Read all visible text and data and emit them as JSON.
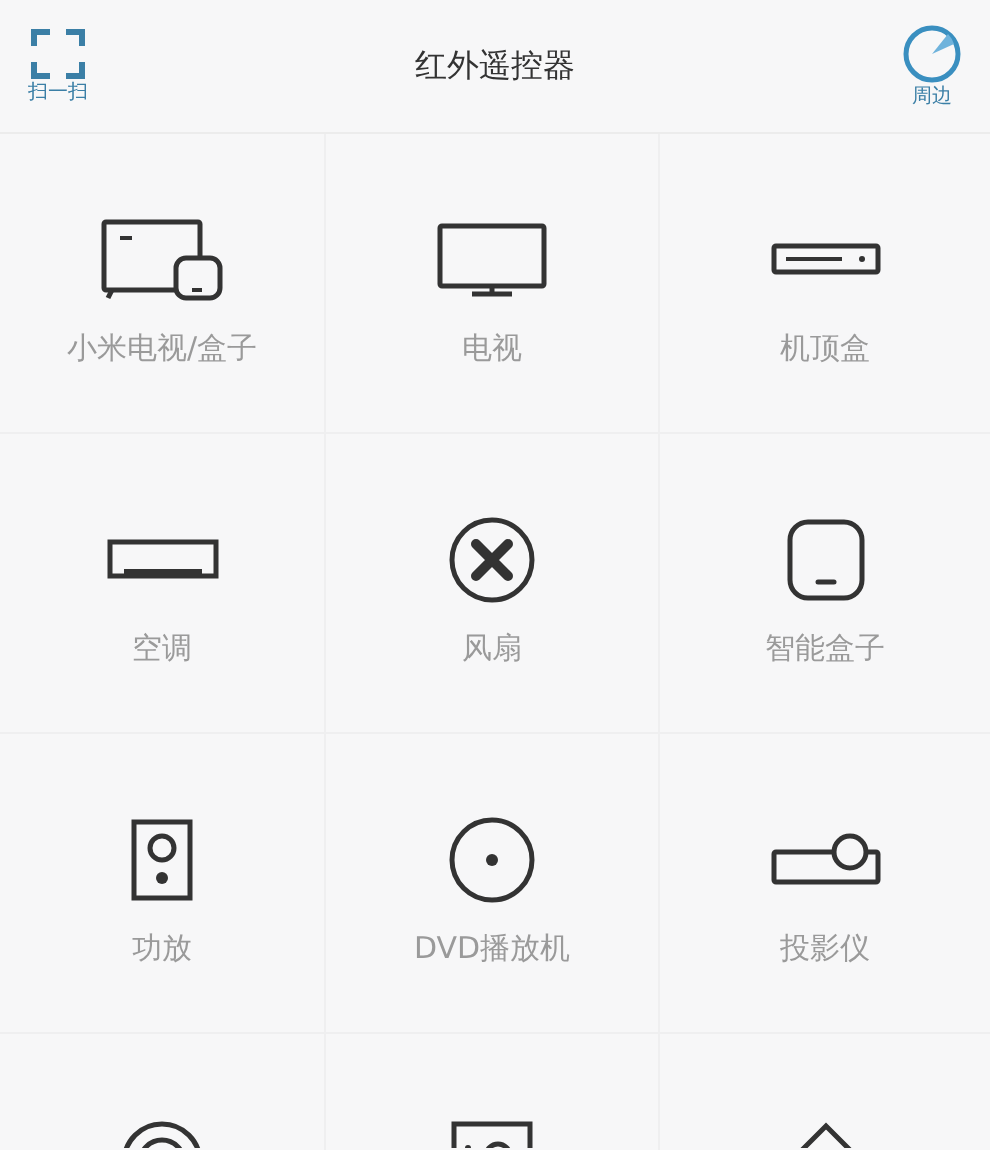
{
  "header": {
    "scan": {
      "label": "扫一扫"
    },
    "title": "红外遥控器",
    "nearby": {
      "label": "周边"
    }
  },
  "devices": [
    {
      "kind": "mitv",
      "label": "小米电视/盒子"
    },
    {
      "kind": "tv",
      "label": "电视"
    },
    {
      "kind": "stb",
      "label": "机顶盒"
    },
    {
      "kind": "ac",
      "label": "空调"
    },
    {
      "kind": "fan",
      "label": "风扇"
    },
    {
      "kind": "box",
      "label": "智能盒子"
    },
    {
      "kind": "amp",
      "label": "功放"
    },
    {
      "kind": "dvd",
      "label": "DVD播放机"
    },
    {
      "kind": "projector",
      "label": "投影仪"
    },
    {
      "kind": "lens"
    },
    {
      "kind": "frame"
    },
    {
      "kind": "roof"
    }
  ]
}
